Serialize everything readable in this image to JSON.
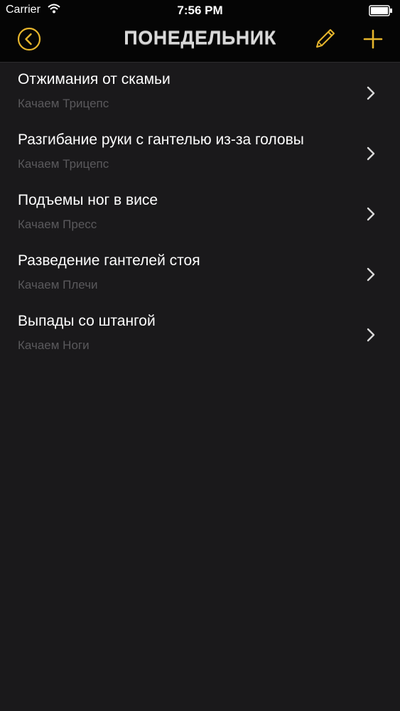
{
  "status_bar": {
    "carrier": "Carrier",
    "time": "7:56 PM"
  },
  "nav": {
    "title": "ПОНЕДЕЛЬНИК",
    "back_icon": "circle-chevron-left-icon",
    "edit_icon": "pencil-icon",
    "add_icon": "plus-icon"
  },
  "exercises": [
    {
      "name": "Отжимания от скамьи",
      "muscle": "Качаем Трицепс"
    },
    {
      "name": "Разгибание руки с гантелью из-за головы",
      "muscle": "Качаем Трицепс"
    },
    {
      "name": "Подъемы ног в висе",
      "muscle": "Качаем Пресс"
    },
    {
      "name": "Разведение гантелей стоя",
      "muscle": "Качаем Плечи"
    },
    {
      "name": "Выпады со штангой",
      "muscle": "Качаем Ноги"
    }
  ],
  "colors": {
    "accent": "#e6b52c",
    "background": "#1a191b",
    "header": "#050505",
    "subtitle": "#5a595c"
  }
}
